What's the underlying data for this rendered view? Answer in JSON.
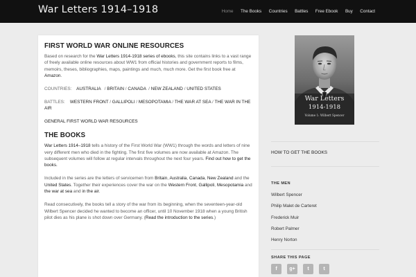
{
  "header": {
    "site_title": "War Letters 1914–1918",
    "nav": [
      "Home",
      "The Books",
      "Countries",
      "Battles",
      "Free Ebook",
      "Buy",
      "Contact"
    ]
  },
  "main": {
    "resources": {
      "heading": "FIRST WORLD WAR ONLINE RESOURCES",
      "intro_pre": "Based on research for the ",
      "intro_link": "War Letters 1914-1918 series of ebooks",
      "intro_mid": ", this site contains links to a vast range of freely available online resources about WW1 from  official histories and government reports to  films, memoirs, theses, bibliographies, maps, paintings and much, much more. Get the first book free at ",
      "intro_link2": "Amazon",
      "intro_end": ".",
      "countries_label": "COUNTRIES:",
      "countries": [
        "AUSTRALIA",
        "BRITAIN",
        "CANADA",
        "NEW ZEALAND",
        "UNITED STATES"
      ],
      "battles_label": "BATTLES:",
      "battles": [
        "WESTERN FRONT",
        "GALLIPOLI",
        "MESOPOTAMIA",
        "THE WAR AT SEA",
        "THE WAR IN THE AIR"
      ],
      "general_link": "GENERAL FIRST WORLD WAR RESOURCES"
    },
    "books": {
      "heading": "THE BOOKS",
      "p1_link": "War Letters 1914–1918",
      "p1_text": " tells a history of the First World War (WW1) through the words and letters of nine very different men who died in the fighting. The first five volumes are now available at Amazon. The subsequent volumes will follow at regular intervals throughout the next four years. ",
      "p1_link2": "Find out how to get the books.",
      "p2_pre": "Included in the series are the letters of servicemen from ",
      "p2_britain": "Britain",
      "p2_australia": "Australia",
      "p2_canada": "Canada",
      "p2_nz": "New Zealand",
      "p2_and": " and the ",
      "p2_us": "United States",
      "p2_mid": ". Together their experiences cover the war on the ",
      "p2_wf": "Western Front",
      "p2_gallipoli": "Gallipoli",
      "p2_meso": "Mesopotamia",
      "p2_and2": " and ",
      "p2_sea": "the war at sea",
      "p2_and3": " and ",
      "p2_air": "in the air",
      "p2_end": ".",
      "comma": ", ",
      "p3_text": "Read consecutively, the books tell a story of the war from its beginning, when the seventeen-year-old Wilbert Spencer decided he wanted to become an officer, until 10 November 1918 when a young British pilot dies as his plane is shot down over Germany. (",
      "p3_link": "Read the introduction to the series",
      "p3_end": ".)"
    }
  },
  "sidebar": {
    "cover": {
      "title": "War Letters",
      "years": "1914-1918",
      "subtitle": "Volume 1: Wilbert Spencer"
    },
    "how_to_get": "HOW TO GET THE BOOKS",
    "men_heading": "THE MEN",
    "men": [
      "Wilbert Spencer",
      "Philip Malet de Carteret",
      "Frederick Muir",
      "Robert Palmer",
      "Henry Norton"
    ],
    "share_heading": "SHARE THIS PAGE",
    "share_icons": [
      {
        "name": "facebook-icon",
        "glyph": "f"
      },
      {
        "name": "google-plus-icon",
        "glyph": "g+"
      },
      {
        "name": "tumblr-icon",
        "glyph": "t"
      },
      {
        "name": "twitter-icon",
        "glyph": "t"
      }
    ]
  }
}
